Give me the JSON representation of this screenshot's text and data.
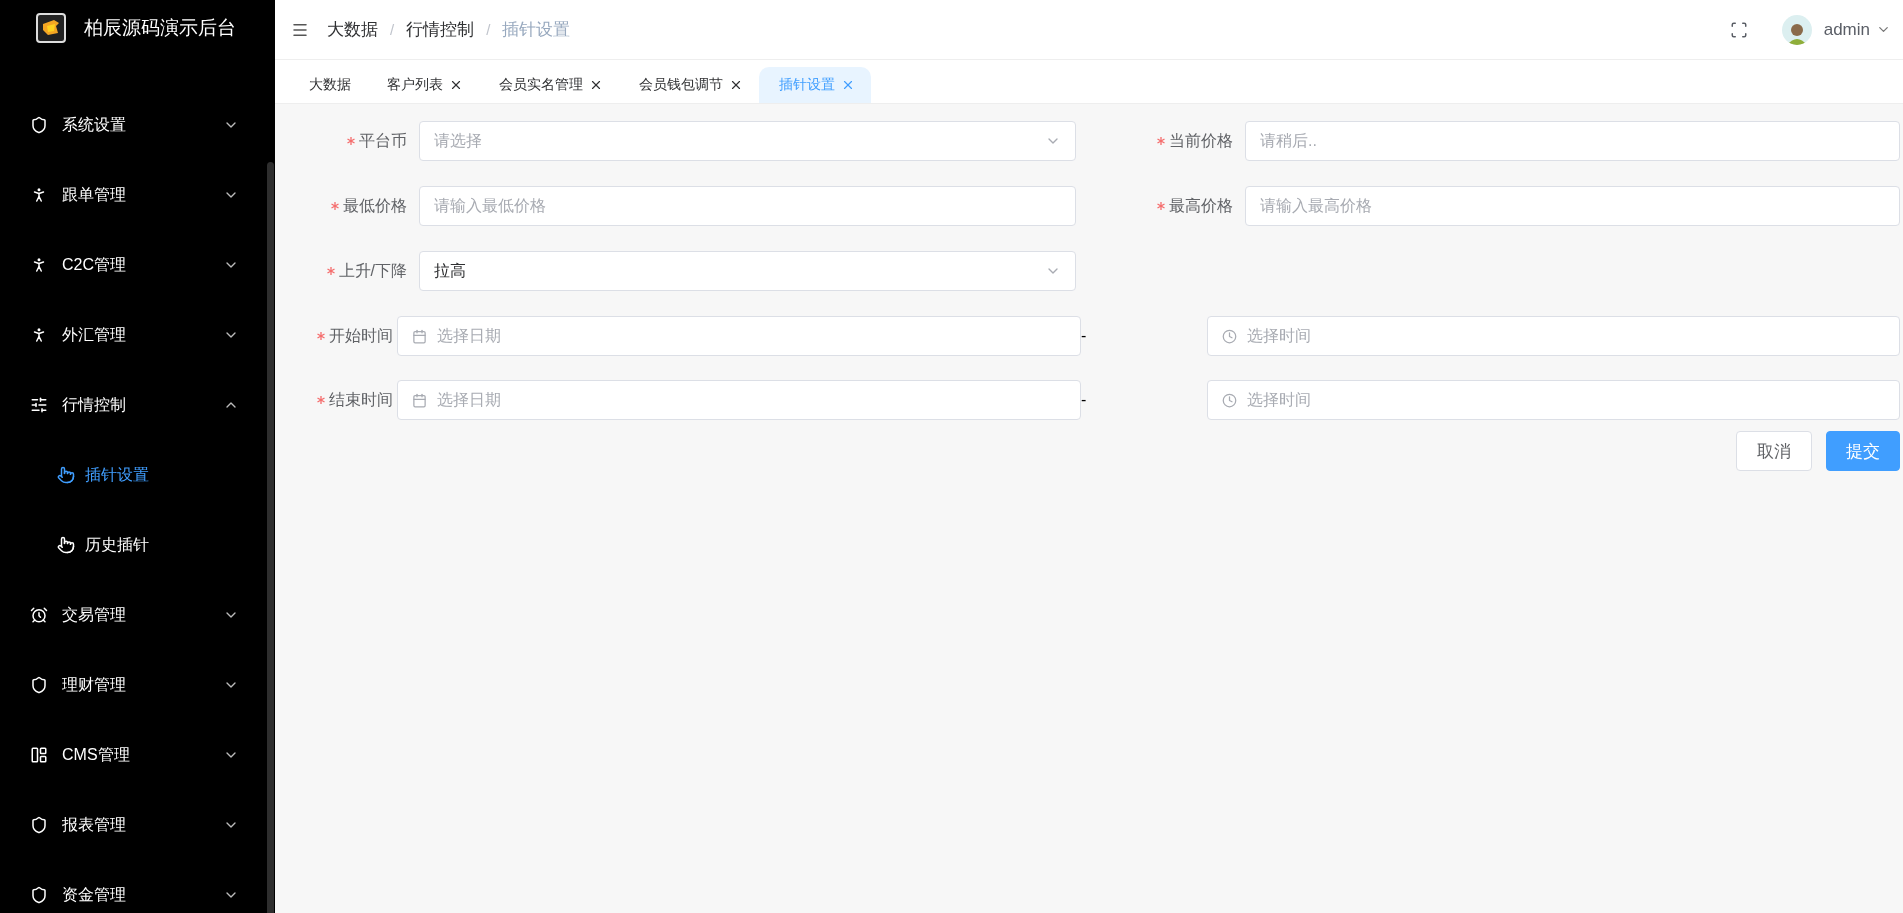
{
  "app": {
    "title": "柏辰源码演示后台"
  },
  "sidebar": {
    "items": [
      {
        "label": "系统设置",
        "kind": "shield",
        "expanded": false
      },
      {
        "label": "跟单管理",
        "kind": "person",
        "expanded": false
      },
      {
        "label": "C2C管理",
        "kind": "person",
        "expanded": false
      },
      {
        "label": "外汇管理",
        "kind": "person",
        "expanded": false
      },
      {
        "label": "行情控制",
        "kind": "sliders",
        "expanded": true,
        "children": [
          {
            "label": "插针设置",
            "selected": true
          },
          {
            "label": "历史插针",
            "selected": false
          }
        ]
      },
      {
        "label": "交易管理",
        "kind": "alarm",
        "expanded": false
      },
      {
        "label": "理财管理",
        "kind": "shield",
        "expanded": false
      },
      {
        "label": "CMS管理",
        "kind": "layout",
        "expanded": false
      },
      {
        "label": "报表管理",
        "kind": "shield",
        "expanded": false
      },
      {
        "label": "资金管理",
        "kind": "shield",
        "expanded": false
      }
    ]
  },
  "header": {
    "breadcrumb": {
      "items": [
        "大数据",
        "行情控制",
        "插针设置"
      ],
      "separator": "/"
    },
    "user": {
      "name": "admin"
    }
  },
  "tabs": [
    {
      "label": "大数据",
      "closable": false,
      "selected": false
    },
    {
      "label": "客户列表",
      "closable": true,
      "selected": false
    },
    {
      "label": "会员实名管理",
      "closable": true,
      "selected": false
    },
    {
      "label": "会员钱包调节",
      "closable": true,
      "selected": false
    },
    {
      "label": "插针设置",
      "closable": true,
      "selected": true
    }
  ],
  "form": {
    "rows": [
      {
        "kind": "pair",
        "fields": [
          {
            "label": "平台币",
            "required": true,
            "kind": "select",
            "placeholder": "请选择"
          },
          {
            "label": "当前价格",
            "required": true,
            "kind": "input",
            "placeholder": "请稍后.."
          }
        ]
      },
      {
        "kind": "pair",
        "fields": [
          {
            "label": "最低价格",
            "required": true,
            "kind": "input",
            "placeholder": "请输入最低价格"
          },
          {
            "label": "最高价格",
            "required": true,
            "kind": "input",
            "placeholder": "请输入最高价格"
          }
        ]
      },
      {
        "kind": "pair",
        "fields": [
          {
            "label": "上升/下降",
            "required": true,
            "kind": "select",
            "value": "拉高"
          }
        ]
      },
      {
        "kind": "range",
        "label": "开始时间",
        "required": true,
        "date_placeholder": "选择日期",
        "separator": "-",
        "time_placeholder": "选择时间"
      },
      {
        "kind": "range",
        "label": "结束时间",
        "required": true,
        "date_placeholder": "选择日期",
        "separator": "-",
        "time_placeholder": "选择时间"
      }
    ],
    "buttons": [
      {
        "label": "取消",
        "kind": "default"
      },
      {
        "label": "提交",
        "kind": "primary"
      }
    ]
  }
}
